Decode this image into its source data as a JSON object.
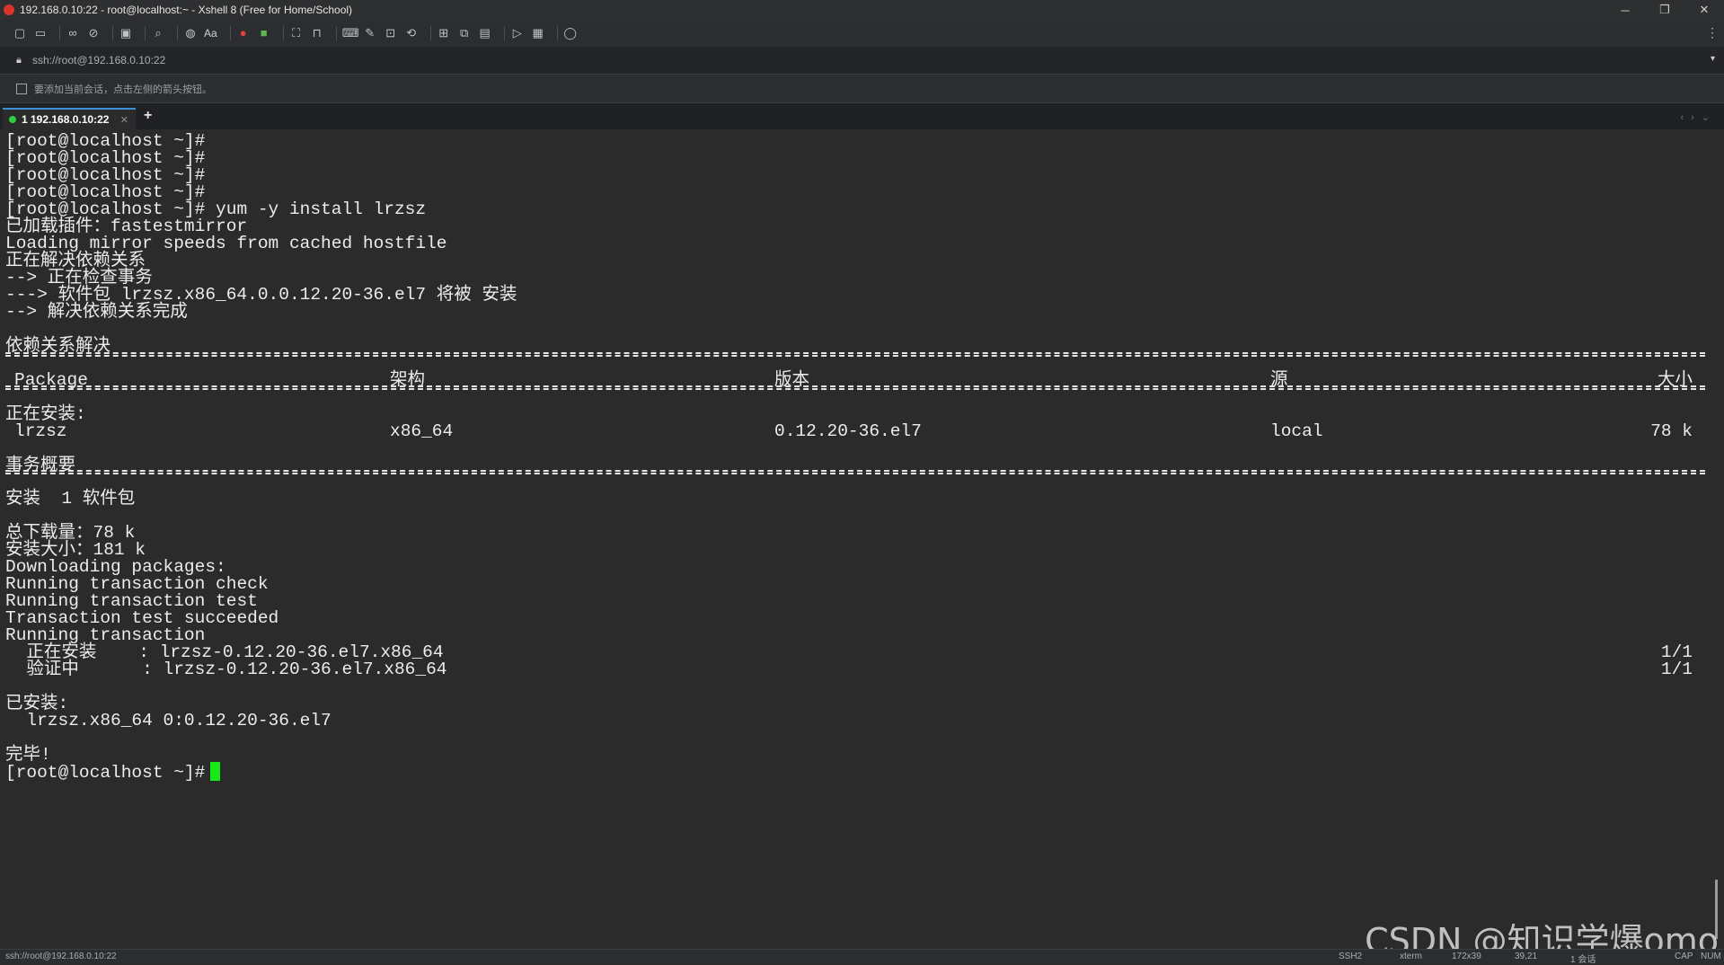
{
  "window": {
    "title": "192.168.0.10:22 - root@localhost:~ - Xshell 8 (Free for Home/School)",
    "minimize": "─",
    "restore": "❐",
    "close": "✕"
  },
  "toolbar": {
    "font_label": "Aa",
    "more": "⋮"
  },
  "address": {
    "text": "ssh://root@192.168.0.10:22",
    "dropdown": "▾"
  },
  "hint": {
    "text": "要添加当前会话，点击左侧的箭头按钮。"
  },
  "tabs": [
    {
      "label": "1 192.168.0.10:22",
      "close": "✕",
      "active": true,
      "status_color": "#2ecc40"
    }
  ],
  "tab_add": "+",
  "tab_nav": "‹›⌄",
  "terminal": {
    "lines": [
      "[root@localhost ~]#",
      "[root@localhost ~]#",
      "[root@localhost ~]#",
      "[root@localhost ~]#",
      "[root@localhost ~]# yum -y install lrzsz",
      "已加载插件：fastestmirror",
      "Loading mirror speeds from cached hostfile",
      "正在解决依赖关系",
      "--> 正在检查事务",
      "---> 软件包 lrzsz.x86_64.0.0.12.20-36.el7 将被 安装",
      "--> 解决依赖关系完成",
      "",
      "依赖关系解决"
    ],
    "table_header": {
      "package": "Package",
      "arch": "架构",
      "version": "版本",
      "repo": "源",
      "size": "大小"
    },
    "installing_label": "正在安装:",
    "package_row": {
      "name": "lrzsz",
      "arch": "x86_64",
      "version": "0.12.20-36.el7",
      "repo": "local",
      "size": "78 k"
    },
    "summary_label": "事务概要",
    "install_count": "安装  1 软件包",
    "lines2": [
      "总下载量：78 k",
      "安装大小：181 k",
      "Downloading packages:",
      "Running transaction check",
      "Running transaction test",
      "Transaction test succeeded",
      "Running transaction"
    ],
    "progress": [
      {
        "label": "  正在安装    : lrzsz-0.12.20-36.el7.x86_64",
        "count": "1/1"
      },
      {
        "label": "  验证中      : lrzsz-0.12.20-36.el7.x86_64",
        "count": "1/1"
      }
    ],
    "installed_label": "已安装:",
    "installed_pkg": "  lrzsz.x86_64 0:0.12.20-36.el7",
    "done_label": "完毕!",
    "prompt": "[root@localhost ~]#"
  },
  "status": {
    "left": "ssh://root@192.168.0.10:22",
    "ssh": "SSH2",
    "term": "xterm",
    "size": "172x39",
    "pos": "39,21",
    "sessions": "1 会话",
    "cap": "CAP",
    "num": "NUM"
  },
  "watermark": "CSDN @知识学爆omo"
}
